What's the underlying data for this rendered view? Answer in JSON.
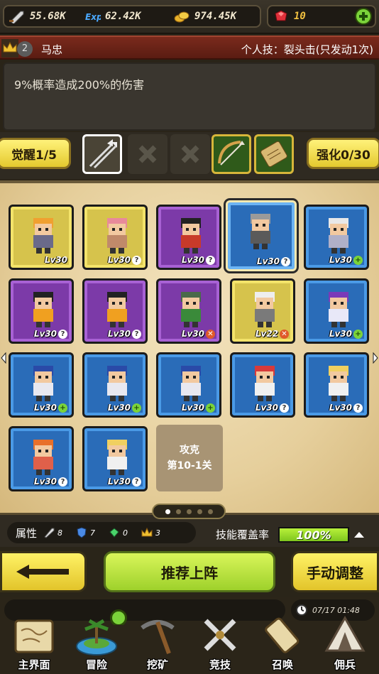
{
  "resources": {
    "attack": "55.68K",
    "exp": "62.42K",
    "gold": "974.45K",
    "gems": "10"
  },
  "hero": {
    "level_badge": "2",
    "name": "马忠",
    "skill_title": "个人技：裂头击(只发动1次)",
    "description": "9%概率造成200%的伤害"
  },
  "awaken": {
    "label": "觉醒1/5"
  },
  "enhance": {
    "label": "强化0/30"
  },
  "grid": {
    "cards": [
      {
        "lv": "Lv30",
        "badge": ""
      },
      {
        "lv": "Lv30",
        "badge": "?"
      },
      {
        "lv": "Lv30",
        "badge": "?"
      },
      {
        "lv": "Lv30",
        "badge": "?"
      },
      {
        "lv": "Lv30",
        "badge": "+"
      },
      {
        "lv": "Lv30",
        "badge": "?"
      },
      {
        "lv": "Lv30",
        "badge": "?"
      },
      {
        "lv": "Lv30",
        "badge": "✕"
      },
      {
        "lv": "Lv22",
        "badge": "✕"
      },
      {
        "lv": "Lv30",
        "badge": "+"
      },
      {
        "lv": "Lv30",
        "badge": "+"
      },
      {
        "lv": "Lv30",
        "badge": "+"
      },
      {
        "lv": "Lv30",
        "badge": "+"
      },
      {
        "lv": "Lv30",
        "badge": "?"
      },
      {
        "lv": "Lv30",
        "badge": "?"
      },
      {
        "lv": "Lv30",
        "badge": "?"
      },
      {
        "lv": "Lv30",
        "badge": "?"
      }
    ],
    "locked_line1": "攻克",
    "locked_line2": "第10-1关"
  },
  "attributes": {
    "label": "属性",
    "values": [
      "8",
      "7",
      "0",
      "3"
    ],
    "coverage_label": "技能覆盖率",
    "coverage_value": "100%",
    "coverage_fraction": 1.0
  },
  "actions": {
    "recommend": "推荐上阵",
    "manual": "手动调整"
  },
  "clock": "07/17 01:48",
  "nav": [
    "主界面",
    "冒险",
    "挖矿",
    "竞技",
    "召唤",
    "佣兵"
  ],
  "colors": {
    "accent_yellow": "#e4c92e",
    "accent_green": "#9ed12b",
    "card_purple": "#7c3aa8",
    "card_blue": "#2a6cb8",
    "card_gold": "#d6c34c"
  }
}
